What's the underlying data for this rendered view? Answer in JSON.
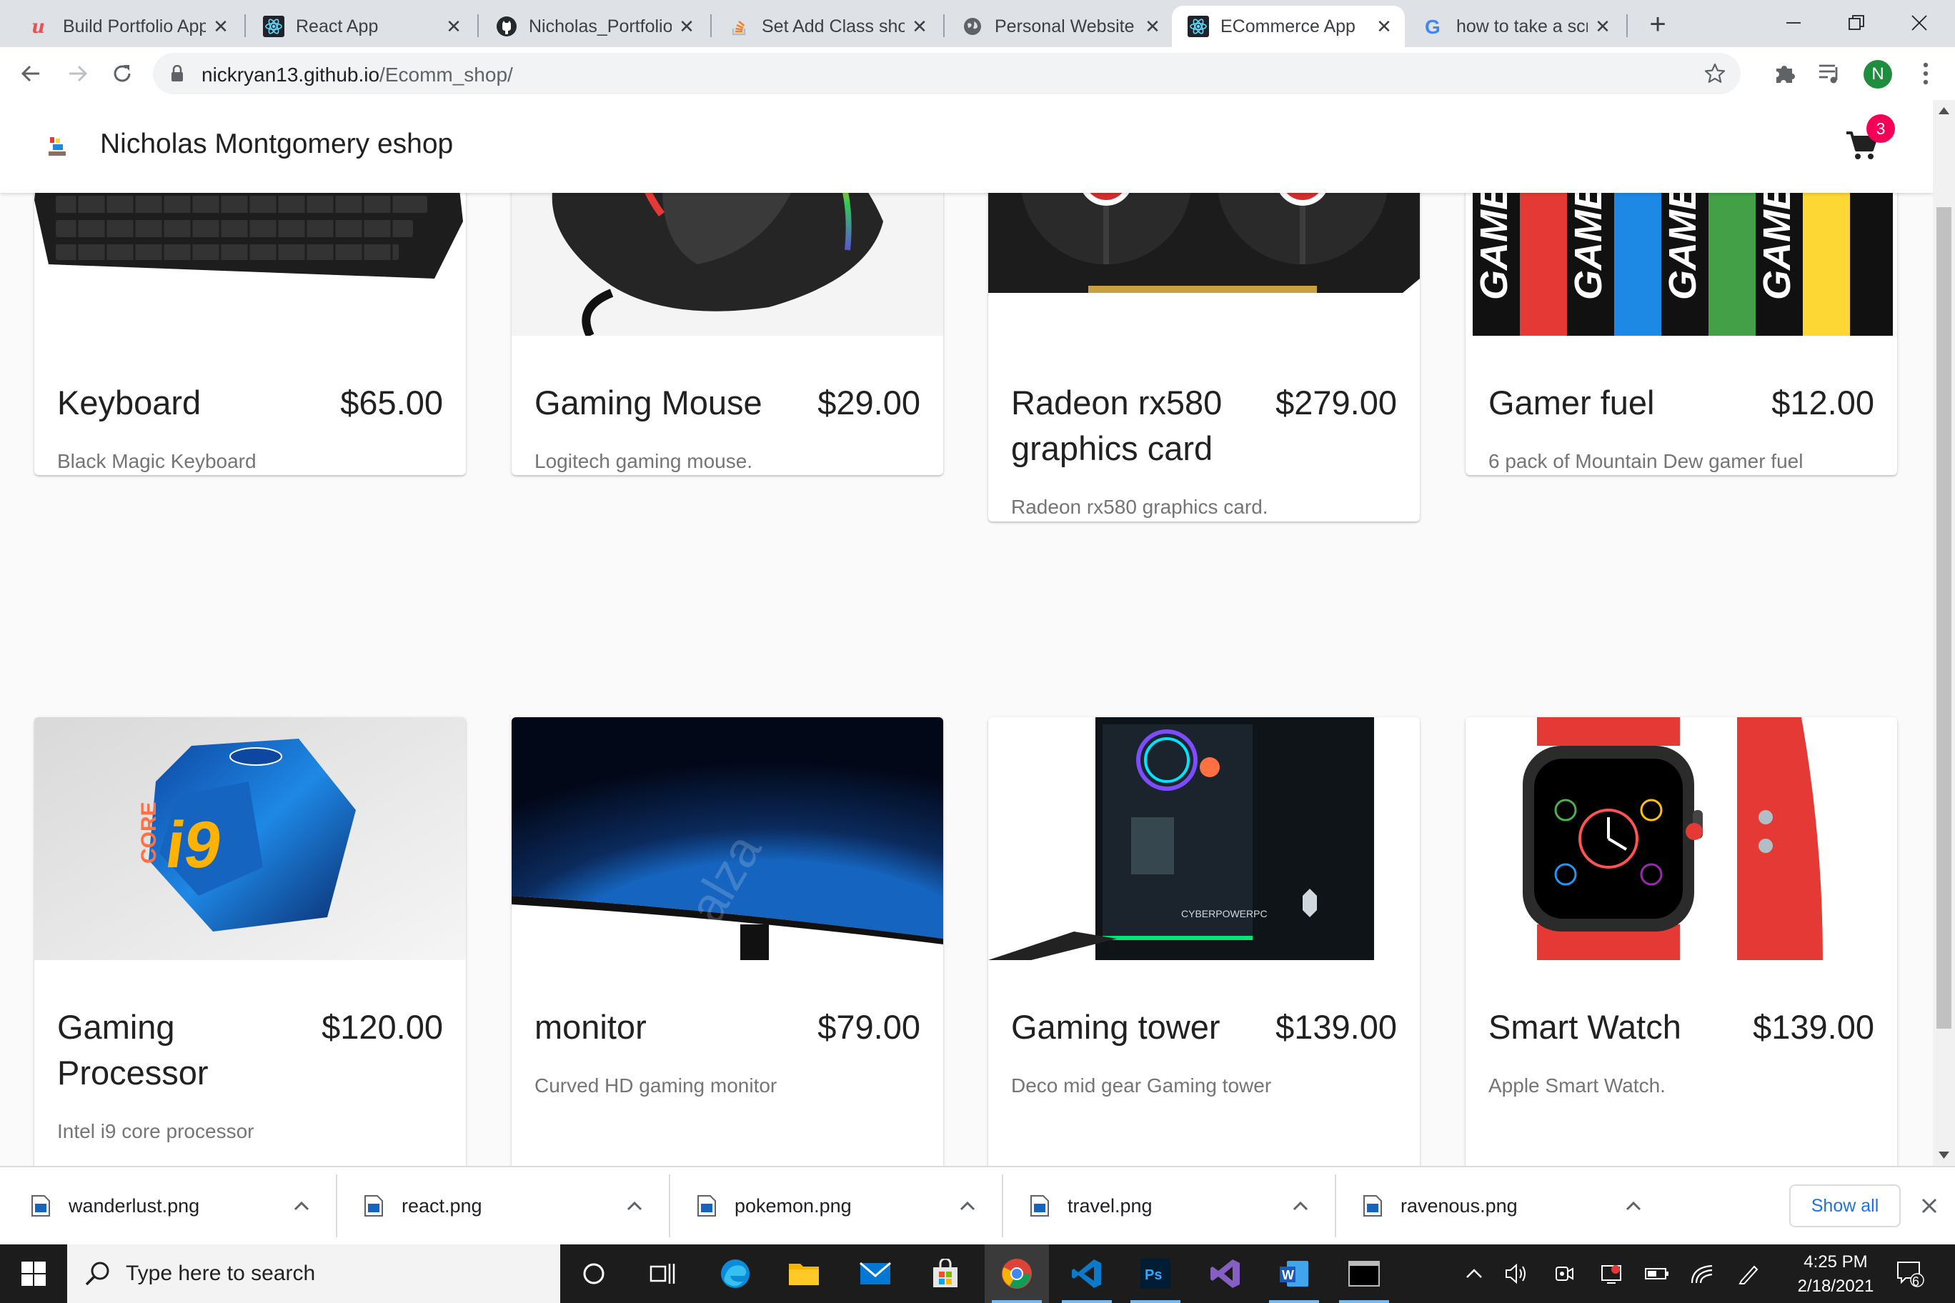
{
  "browser": {
    "tabs": [
      {
        "title": "Build Portfolio App",
        "icon": "udemy-icon",
        "active": false
      },
      {
        "title": "React App",
        "icon": "react-icon",
        "active": false
      },
      {
        "title": "Nicholas_Portfolio",
        "icon": "github-icon",
        "active": false
      },
      {
        "title": "Set Add Class shor",
        "icon": "stackoverflow-icon",
        "active": false
      },
      {
        "title": "Personal Website",
        "icon": "globe-icon",
        "active": false
      },
      {
        "title": "ECommerce App",
        "icon": "react-icon",
        "active": true
      },
      {
        "title": "how to take a scre",
        "icon": "google-icon",
        "active": false
      }
    ],
    "new_tab": "+",
    "url_host": "nickryan13.github.io",
    "url_path": "/Ecomm_shop/",
    "profile_initial": "N"
  },
  "page": {
    "brand_title": "Nicholas Montgomery eshop",
    "cart_count": "3",
    "products": [
      {
        "name": "Keyboard",
        "price": "$65.00",
        "description": "Black Magic Keyboard"
      },
      {
        "name": "Gaming Mouse",
        "price": "$29.00",
        "description": "Logitech gaming mouse."
      },
      {
        "name": "Radeon rx580 graphics card",
        "price": "$279.00",
        "description": "Radeon rx580 graphics card."
      },
      {
        "name": "Gamer fuel",
        "price": "$12.00",
        "description": "6 pack of Mountain Dew gamer fuel"
      },
      {
        "name": "Gaming Processor",
        "price": "$120.00",
        "description": "Intel i9 core processor"
      },
      {
        "name": "monitor",
        "price": "$79.00",
        "description": "Curved HD gaming monitor"
      },
      {
        "name": "Gaming tower",
        "price": "$139.00",
        "description": "Deco mid gear Gaming tower"
      },
      {
        "name": "Smart Watch",
        "price": "$139.00",
        "description": "Apple Smart Watch."
      }
    ]
  },
  "downloads": {
    "items": [
      "wanderlust.png",
      "react.png",
      "pokemon.png",
      "travel.png",
      "ravenous.png"
    ],
    "show_all": "Show all"
  },
  "taskbar": {
    "search_placeholder": "Type here to search",
    "time": "4:25 PM",
    "date": "2/18/2021",
    "notification_count": "6"
  },
  "colors": {
    "badge": "#f50057",
    "active_tab": "#ffffff",
    "tab_strip": "#dee1e6",
    "link_blue": "#1a73e8"
  }
}
